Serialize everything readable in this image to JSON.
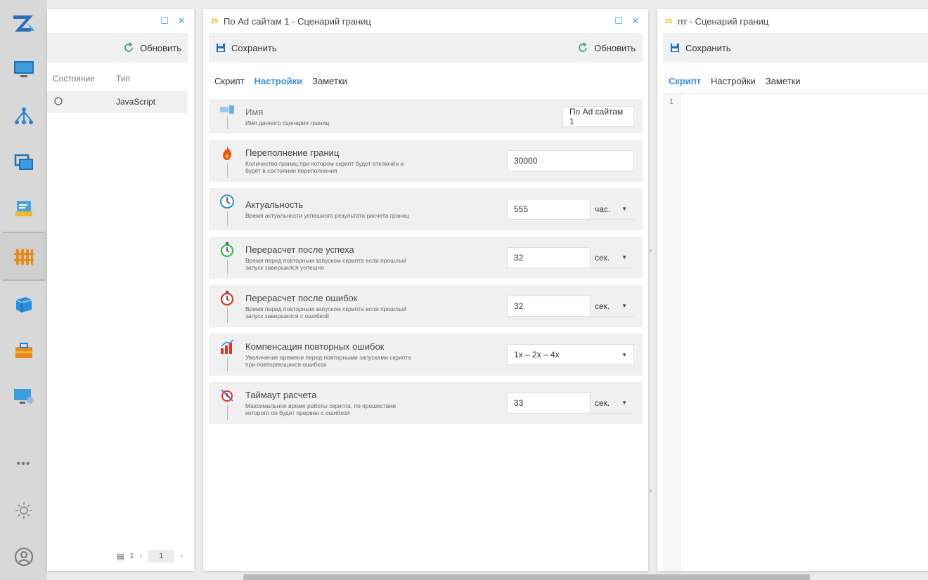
{
  "rail": {
    "items": [
      {
        "name": "logo-icon"
      },
      {
        "name": "monitor-icon"
      },
      {
        "name": "network-icon"
      },
      {
        "name": "windows-icon"
      },
      {
        "name": "report-icon"
      },
      {
        "name": "fence-icon"
      },
      {
        "name": "cube-icon"
      },
      {
        "name": "toolbox-icon"
      },
      {
        "name": "remote-desktop-icon"
      },
      {
        "name": "more-icon"
      },
      {
        "name": "settings-sun-icon"
      },
      {
        "name": "user-icon"
      }
    ],
    "more_label": "•••"
  },
  "panel1": {
    "refresh_label": "Обновить",
    "columns": [
      "Состояние",
      "Тип"
    ],
    "rows": [
      {
        "type": "JavaScript"
      }
    ],
    "pager": {
      "count": "1",
      "page": "1"
    }
  },
  "panel2": {
    "badge": "JS",
    "title": "По Ad сайтам 1 - Сценарий границ",
    "save_label": "Сохранить",
    "refresh_label": "Обновить",
    "tabs": [
      "Скрипт",
      "Настройки",
      "Заметки"
    ],
    "settings": [
      {
        "title": "Имя",
        "desc": "Имя данного сценария границ",
        "value": "По Ad сайтам 1"
      },
      {
        "title": "Переполнение границ",
        "desc": "Количество границ при котором скрипт будет отключён и будет в состоянии переполнения",
        "value": "30000"
      },
      {
        "title": "Актуальность",
        "desc": "Время актуальности успешного результата расчета границ",
        "value": "555",
        "unit": "час."
      },
      {
        "title": "Перерасчет после успеха",
        "desc": "Время перед повторным запуском скрипта если прошлый запуск завершился успешно",
        "value": "32",
        "unit": "сек."
      },
      {
        "title": "Перерасчет после ошибок",
        "desc": "Время перед повторным запуском скрипта если прошлый запуск завершился с ошибкой",
        "value": "32",
        "unit": "сек."
      },
      {
        "title": "Компенсация повторных ошибок",
        "desc": "Увеличение времени перед повторными запусками скрипта при повторяющихся ошибках",
        "value": "1x – 2x – 4x"
      },
      {
        "title": "Таймаут расчета",
        "desc": "Максимальное время работы скрипта, по прошествии которого он будет прерван с ошибкой",
        "value": "33",
        "unit": "сек."
      }
    ]
  },
  "panel3": {
    "badge": "JS",
    "title": "rrr - Сценарий границ",
    "save_label": "Сохранить",
    "tabs": [
      "Скрипт",
      "Настройки",
      "Заметки"
    ],
    "line_number": "1"
  },
  "colors": {
    "accent": "#3b8fd6",
    "js_badge": "#e6b800",
    "panel_bg": "#f0f0f0"
  }
}
